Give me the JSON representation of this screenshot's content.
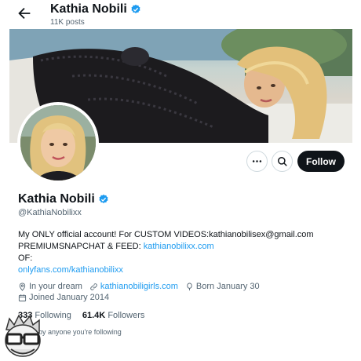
{
  "header": {
    "name": "Kathia Nobili",
    "post_count": "11K posts"
  },
  "actions": {
    "follow_label": "Follow"
  },
  "profile": {
    "name": "Kathia Nobili",
    "handle": "@KathiaNobilixx",
    "bio_line1": "My ONLY official account! For CUSTOM VIDEOS:kathianobilisex@gmail.com",
    "bio_line2_prefix": "PREMIUMSNAPCHAT & FEED: ",
    "bio_line2_link": "kathianobilixx.com",
    "bio_line3": "OF:",
    "bio_line4_link": "onlyfans.com/kathianobilixx",
    "location": "In your dream",
    "website": "kathianobiligirls.com",
    "birthday": "Born January 30",
    "joined": "Joined January 2014",
    "following_count": "333",
    "following_label": "Following",
    "followers_count": "61.4K",
    "followers_label": "Followers",
    "followed_by": "lowed by anyone you're following"
  },
  "colors": {
    "verified": "#1d9bf0",
    "link": "#1d9bf0",
    "follow_button": "#0f1419"
  },
  "icons": [
    "back-arrow-icon",
    "verified-badge-icon",
    "more-icon",
    "search-icon",
    "location-icon",
    "link-icon",
    "balloon-icon",
    "calendar-icon"
  ]
}
